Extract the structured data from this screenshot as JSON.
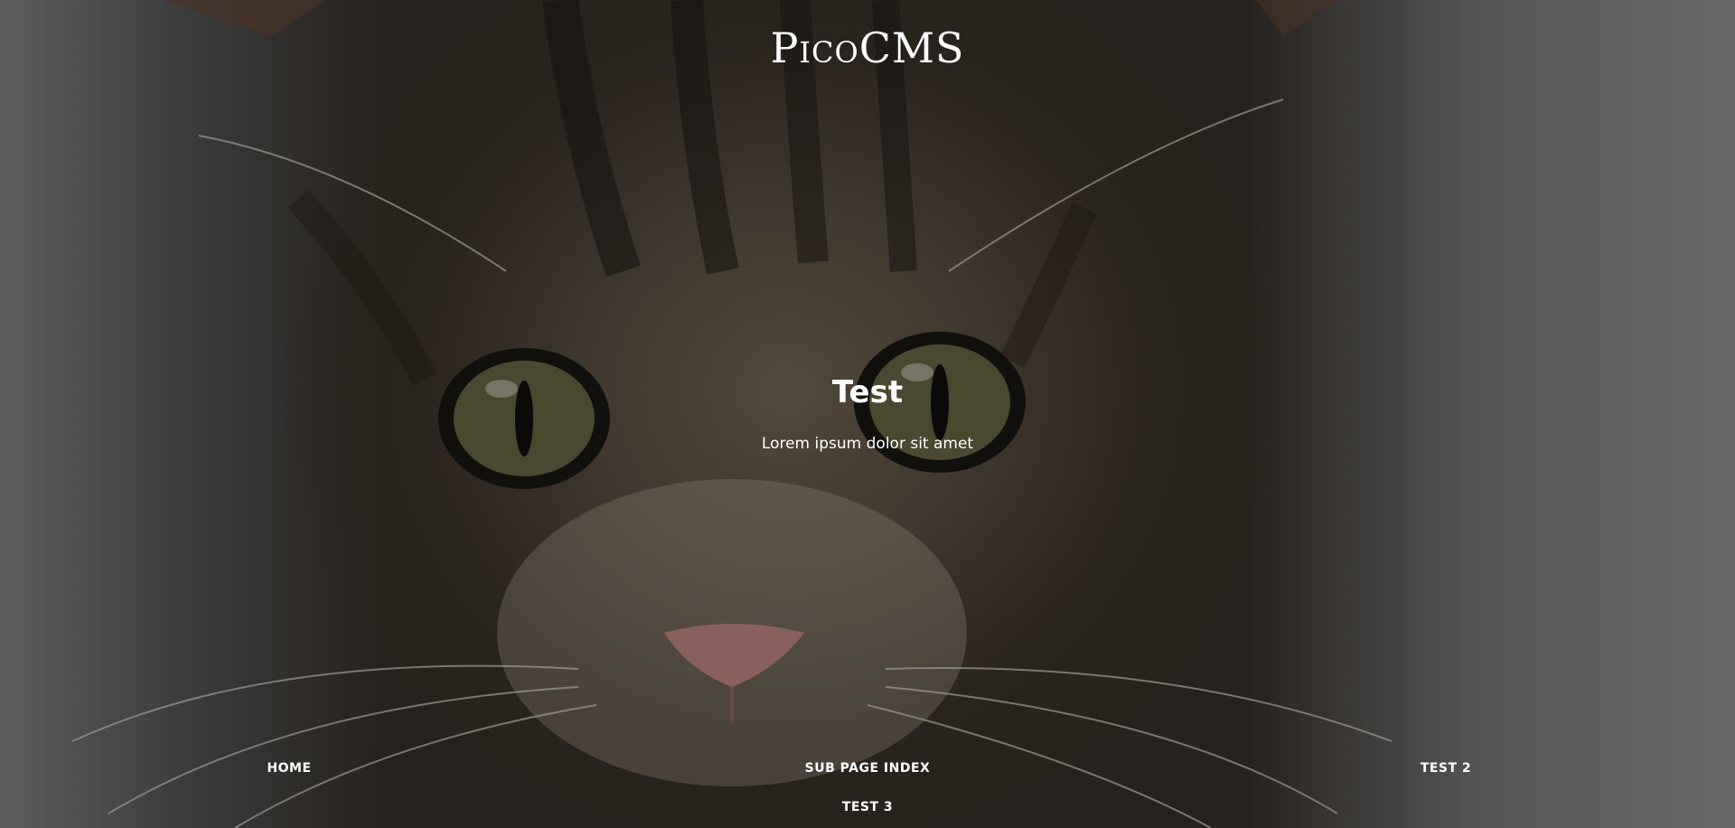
{
  "site": {
    "title": "PicoCMS"
  },
  "page": {
    "title": "Test",
    "description": "Lorem ipsum dolor sit amet"
  },
  "hero": {
    "image": "kitten-photo"
  },
  "nav": {
    "items": [
      {
        "label": "HOME"
      },
      {
        "label": "SUB PAGE INDEX"
      },
      {
        "label": "TEST 2"
      },
      {
        "label": "TEST 3"
      }
    ]
  }
}
